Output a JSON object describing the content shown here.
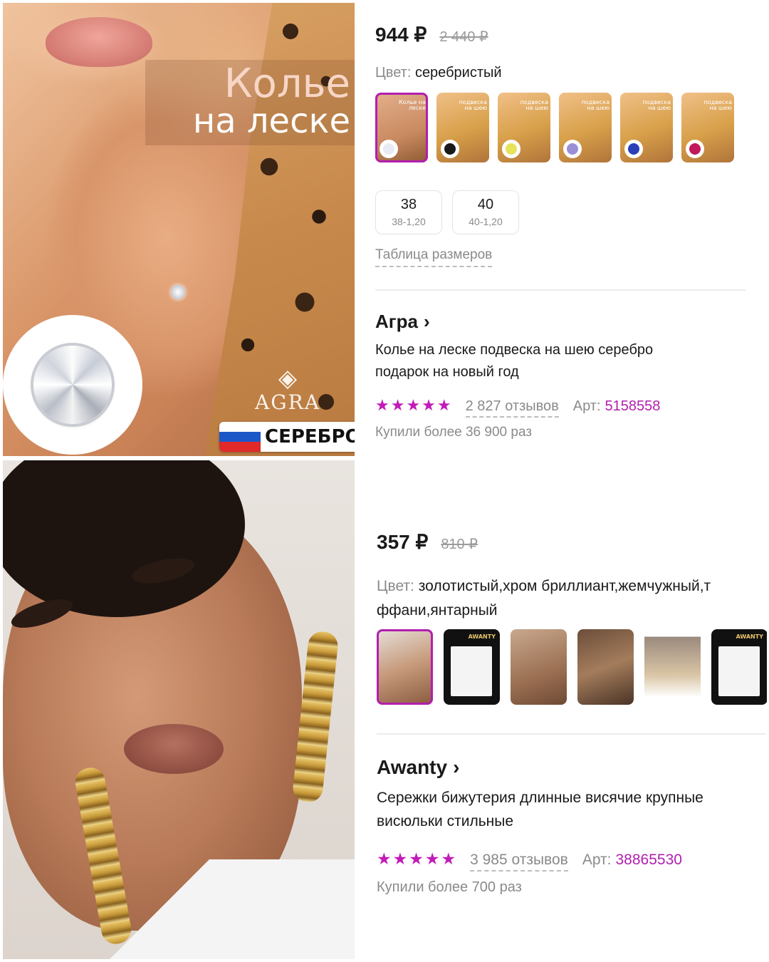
{
  "product1": {
    "photo_title_line1": "Колье",
    "photo_title_line2": "на леске",
    "photo_brand_logo": "AGRA",
    "photo_badge": "СЕРЕБРО",
    "price": "944 ₽",
    "old_price": "2 440 ₽",
    "color_label": "Цвет:",
    "color_value": "серебристый",
    "thumb_captions": [
      "Колье на леске",
      "подвеска на шею",
      "подвеска на шею",
      "подвеска на шею",
      "подвеска на шею",
      "подвеска на шею"
    ],
    "thumb_gem_colors": [
      "#e8ecf2",
      "#1a1a1a",
      "#e6e25a",
      "#9a8fd6",
      "#2a3fb8",
      "#c2185b"
    ],
    "sizes": [
      {
        "main": "38",
        "sub": "38-1,20"
      },
      {
        "main": "40",
        "sub": "40-1,20"
      }
    ],
    "size_table_link": "Таблица размеров",
    "brand": "Агра",
    "title_line1": "Колье на леске подвеска на шею серебро",
    "title_line2": "подарок на новый год",
    "stars": "★★★★★",
    "rating": 5,
    "reviews": "2 827 отзывов",
    "art_label": "Арт:",
    "art_value": "5158558",
    "bought": "Купили более 36 900 раз"
  },
  "product2": {
    "price": "357 ₽",
    "old_price": "810 ₽",
    "color_label": "Цвет:",
    "color_value_line1": "золотистый,хром бриллиант,жемчужный,т",
    "color_value_line2": "ффани,янтарный",
    "thumb_caption": "AWANTY",
    "brand": "Awanty",
    "title_line1": "Сережки бижутерия длинные висячие крупные",
    "title_line2": "висюльки стильные",
    "stars": "★★★★★",
    "rating": 5,
    "reviews": "3 985 отзывов",
    "art_label": "Арт:",
    "art_value": "38865530",
    "bought": "Купили более 700 раз"
  },
  "colors": {
    "accent": "#b21fae",
    "stars": "#c21bb8",
    "muted": "#8a8a8a"
  }
}
